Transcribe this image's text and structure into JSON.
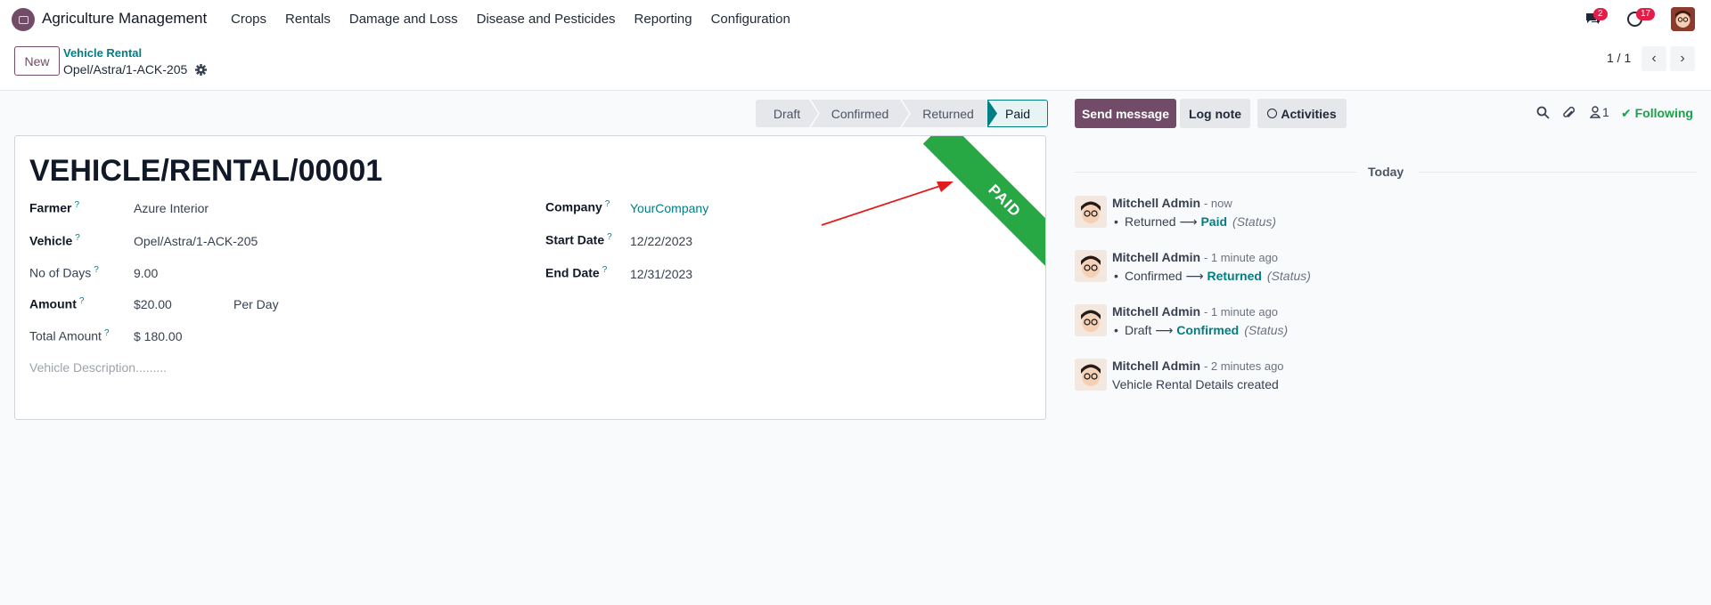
{
  "navbar": {
    "app_name": "Agriculture Management",
    "menu": [
      "Crops",
      "Rentals",
      "Damage and Loss",
      "Disease and Pesticides",
      "Reporting",
      "Configuration"
    ],
    "messages_badge": "2",
    "activities_badge": "17"
  },
  "control": {
    "new_label": "New",
    "breadcrumb_parent": "Vehicle Rental",
    "breadcrumb_current": "Opel/Astra/1-ACK-205",
    "pager": "1 / 1"
  },
  "statusbar": {
    "stages": [
      "Draft",
      "Confirmed",
      "Returned",
      "Paid"
    ],
    "active": "Paid"
  },
  "form": {
    "title": "VEHICLE/RENTAL/00001",
    "ribbon": "PAID",
    "farmer_label": "Farmer",
    "farmer": "Azure Interior",
    "vehicle_label": "Vehicle",
    "vehicle": "Opel/Astra/1-ACK-205",
    "days_label": "No of Days",
    "days": "9.00",
    "amount_label": "Amount",
    "amount": "$20.00",
    "amount_unit": "Per Day",
    "total_label": "Total Amount",
    "total": "$ 180.00",
    "description_placeholder": "Vehicle Description.........",
    "company_label": "Company",
    "company": "YourCompany",
    "start_label": "Start Date",
    "start": "12/22/2023",
    "end_label": "End Date",
    "end": "12/31/2023",
    "help_mark": "?"
  },
  "chatter": {
    "send_message": "Send message",
    "log_note": "Log note",
    "activities": "Activities",
    "followers_count": "1",
    "following": "Following",
    "today": "Today",
    "messages": [
      {
        "author": "Mitchell Admin",
        "time": "- now",
        "from": "Returned",
        "to": "Paid",
        "field": "(Status)"
      },
      {
        "author": "Mitchell Admin",
        "time": "- 1 minute ago",
        "from": "Confirmed",
        "to": "Returned",
        "field": "(Status)"
      },
      {
        "author": "Mitchell Admin",
        "time": "- 1 minute ago",
        "from": "Draft",
        "to": "Confirmed",
        "field": "(Status)"
      },
      {
        "author": "Mitchell Admin",
        "time": "- 2 minutes ago",
        "body": "Vehicle Rental Details created"
      }
    ]
  },
  "colors": {
    "brand": "#714b67",
    "link": "#017e84",
    "ribbon": "#28a745",
    "following": "#16a34a",
    "badge": "#e11d48",
    "annotation_arrow": "#e11d1d"
  }
}
